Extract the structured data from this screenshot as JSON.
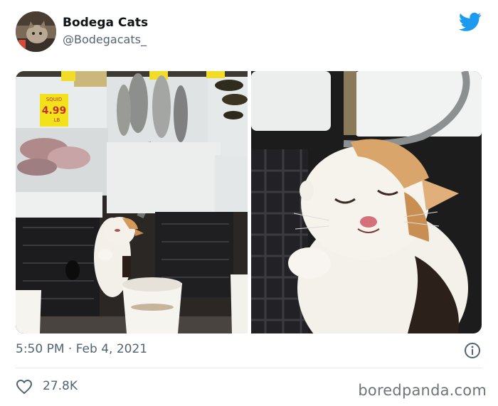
{
  "author": {
    "display_name": "Bodega Cats",
    "handle": "@Bodegacats_"
  },
  "media": {
    "left_photo": {
      "price_sign": {
        "label": "SQUID",
        "price": "4.99",
        "unit": "LB"
      }
    }
  },
  "footer": {
    "timestamp": "5:50 PM · Feb 4, 2021",
    "like_count": "27.8K"
  },
  "watermark": "boredpanda.com",
  "colors": {
    "twitter_blue": "#1d9bf0",
    "secondary_text": "#536471",
    "price_sign_yellow": "#f2e21a"
  },
  "icons": {
    "brand": "twitter-bird-icon",
    "info": "info-icon",
    "like": "heart-icon"
  }
}
